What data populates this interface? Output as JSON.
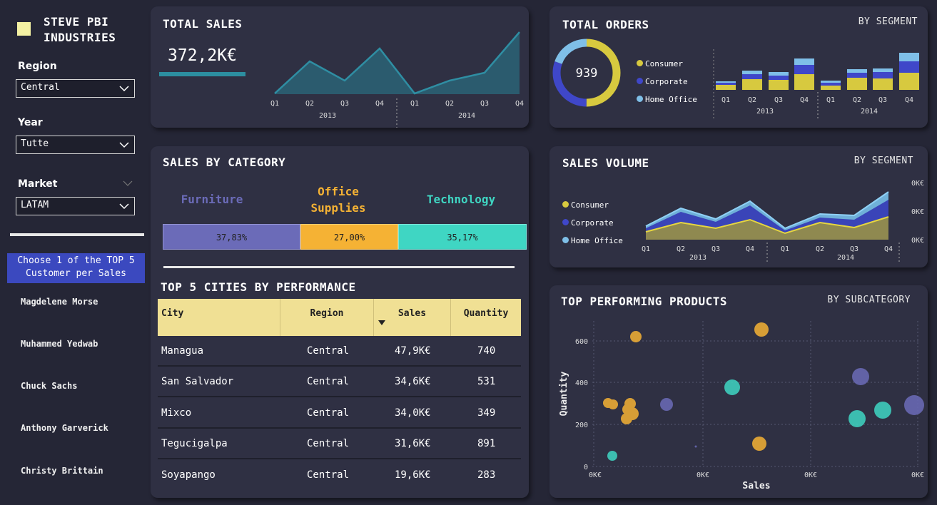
{
  "brand": {
    "line1": "STEVE PBI",
    "line2": "INDUSTRIES"
  },
  "filters": {
    "region": {
      "label": "Region",
      "value": "Central"
    },
    "year": {
      "label": "Year",
      "value": "Tutte"
    },
    "market": {
      "label": "Market",
      "value": "LATAM"
    }
  },
  "top5": {
    "prompt_line1": "Choose 1 of the TOP 5",
    "prompt_line2": "Customer per Sales",
    "customers": [
      "Magdelene Morse",
      "Muhammed Yedwab",
      "Chuck Sachs",
      "Anthony Garverick",
      "Christy Brittain"
    ]
  },
  "total_sales": {
    "title": "TOTAL SALES",
    "value": "372,2K€",
    "quarters": [
      "Q1",
      "Q2",
      "Q3",
      "Q4",
      "Q1",
      "Q2",
      "Q3",
      "Q4"
    ],
    "years": [
      "2013",
      "2014"
    ]
  },
  "total_orders": {
    "title": "TOTAL ORDERS",
    "subtitle": "BY SEGMENT",
    "value": "939",
    "legend": [
      "Consumer",
      "Corporate",
      "Home Office"
    ],
    "quarters": [
      "Q1",
      "Q2",
      "Q3",
      "Q4",
      "Q1",
      "Q2",
      "Q3",
      "Q4"
    ],
    "years": [
      "2013",
      "2014"
    ]
  },
  "sales_by_category": {
    "title": "SALES BY CATEGORY",
    "categories": [
      {
        "line1": "Furniture",
        "line2": "",
        "pct": "37,83%"
      },
      {
        "line1": "Office",
        "line2": "Supplies",
        "pct": "27,00%"
      },
      {
        "line1": "Technology",
        "line2": "",
        "pct": "35,17%"
      }
    ]
  },
  "sales_volume": {
    "title": "SALES VOLUME",
    "subtitle": "BY SEGMENT",
    "legend": [
      "Consumer",
      "Corporate",
      "Home Office"
    ],
    "y_ticks": [
      "0K€",
      "0K€",
      "0K€"
    ],
    "quarters": [
      "Q1",
      "Q2",
      "Q3",
      "Q4",
      "Q1",
      "Q2",
      "Q3",
      "Q4"
    ],
    "years": [
      "2013",
      "2014"
    ]
  },
  "top_cities": {
    "title": "TOP 5 CITIES BY PERFORMANCE",
    "columns": [
      "City",
      "Region",
      "Sales",
      "Quantity"
    ],
    "rows": [
      {
        "city": "Managua",
        "region": "Central",
        "sales": "47,9K€",
        "qty": "740"
      },
      {
        "city": "San Salvador",
        "region": "Central",
        "sales": "34,6K€",
        "qty": "531"
      },
      {
        "city": "Mixco",
        "region": "Central",
        "sales": "34,0K€",
        "qty": "349"
      },
      {
        "city": "Tegucigalpa",
        "region": "Central",
        "sales": "31,6K€",
        "qty": "891"
      },
      {
        "city": "Soyapango",
        "region": "Central",
        "sales": "19,6K€",
        "qty": "283"
      }
    ]
  },
  "top_products": {
    "title": "TOP PERFORMING PRODUCTS",
    "subtitle": "BY SUBCATEGORY",
    "xlabel": "Sales",
    "ylabel": "Quantity",
    "y_ticks": [
      "600",
      "400",
      "200",
      "0"
    ],
    "x_ticks": [
      "0K€",
      "0K€",
      "0K€",
      "0K€"
    ]
  },
  "colors": {
    "consumer": "#d7c93f",
    "corporate": "#3f47c9",
    "home_office": "#7fbfe8",
    "furniture": "#6b6bb8",
    "office": "#f5b234",
    "technology": "#3fd6c3"
  }
}
